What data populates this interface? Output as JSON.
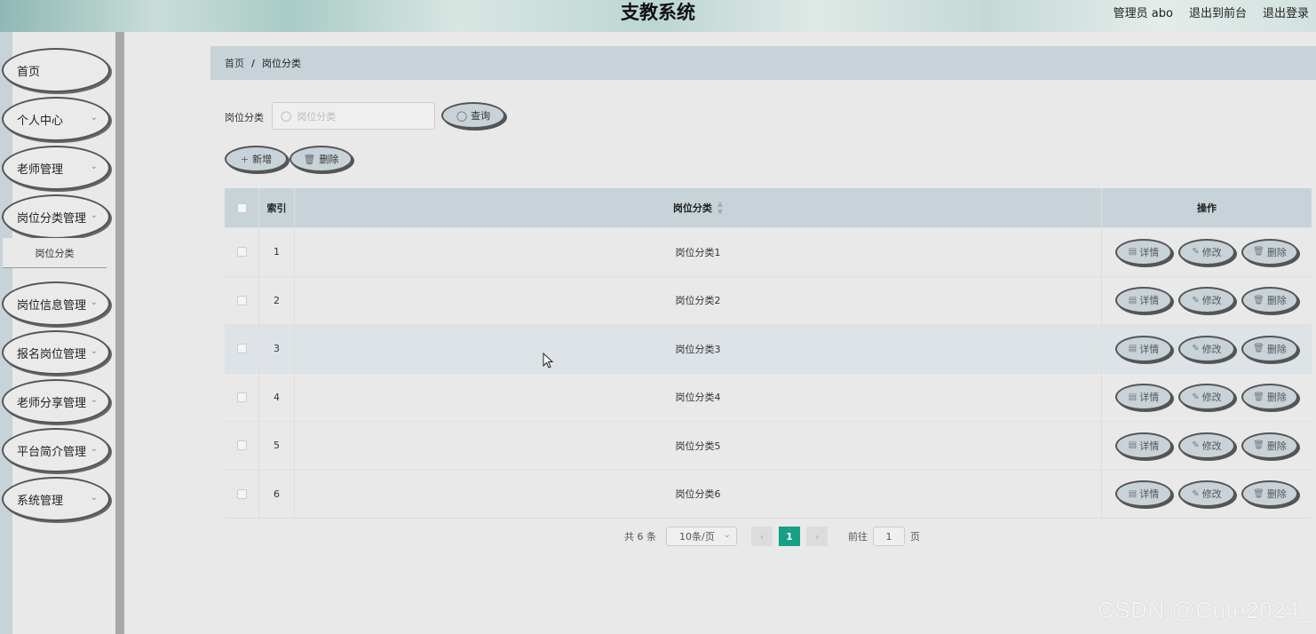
{
  "header": {
    "title": "支教系统",
    "admin_label": "管理员 abo",
    "front_link": "退出到前台",
    "logout_link": "退出登录"
  },
  "sidebar": {
    "items": [
      {
        "label": "首页",
        "has_chevron": false
      },
      {
        "label": "个人中心",
        "has_chevron": true
      },
      {
        "label": "老师管理",
        "has_chevron": true
      },
      {
        "label": "岗位分类管理",
        "has_chevron": true
      },
      {
        "label": "岗位信息管理",
        "has_chevron": true
      },
      {
        "label": "报名岗位管理",
        "has_chevron": true
      },
      {
        "label": "老师分享管理",
        "has_chevron": true
      },
      {
        "label": "平台简介管理",
        "has_chevron": true
      },
      {
        "label": "系统管理",
        "has_chevron": true
      }
    ],
    "submenu_label": "岗位分类"
  },
  "breadcrumb": {
    "home": "首页",
    "separator": "/",
    "current": "岗位分类"
  },
  "search": {
    "label": "岗位分类",
    "placeholder": "岗位分类",
    "button": "查询"
  },
  "actions": {
    "add": "新增",
    "delete": "删除"
  },
  "table": {
    "headers": {
      "index": "索引",
      "name": "岗位分类",
      "ops": "操作"
    },
    "rows": [
      {
        "index": "1",
        "name": "岗位分类1"
      },
      {
        "index": "2",
        "name": "岗位分类2"
      },
      {
        "index": "3",
        "name": "岗位分类3"
      },
      {
        "index": "4",
        "name": "岗位分类4"
      },
      {
        "index": "5",
        "name": "岗位分类5"
      },
      {
        "index": "6",
        "name": "岗位分类6"
      }
    ],
    "op_labels": {
      "detail": "详情",
      "edit": "修改",
      "delete": "删除"
    }
  },
  "pagination": {
    "total": "共 6 条",
    "page_size": "10条/页",
    "current_page": "1",
    "goto_label": "前往",
    "goto_value": "1",
    "page_suffix": "页"
  },
  "watermark": "CSDN @Cute2024_",
  "colors": {
    "accent": "#16a085",
    "panel": "#c7d3d8",
    "background": "#e9e9e9"
  }
}
